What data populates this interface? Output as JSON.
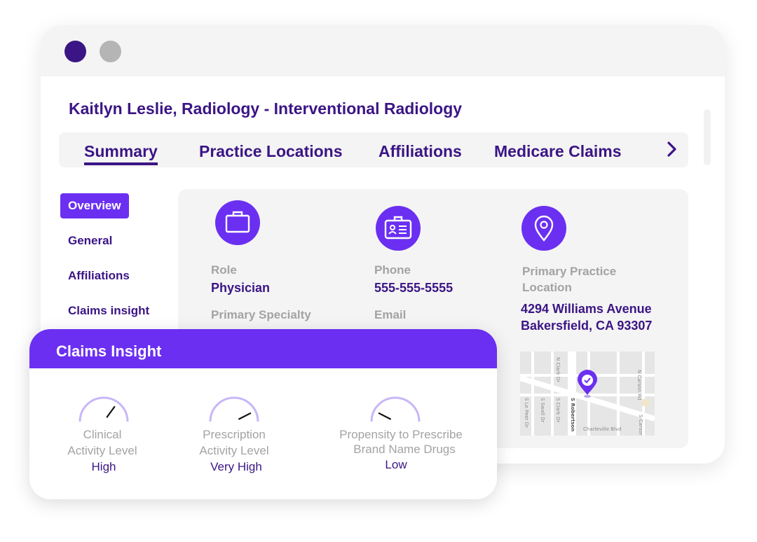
{
  "window": {
    "controls": [
      {
        "name": "close",
        "color": "#3b1585"
      },
      {
        "name": "minimize",
        "color": "#b5b5b5"
      }
    ]
  },
  "header": {
    "title": "Kaitlyn Leslie, Radiology - Interventional Radiology"
  },
  "tabs": [
    {
      "label": "Summary",
      "active": true
    },
    {
      "label": "Practice Locations",
      "active": false
    },
    {
      "label": "Affiliations",
      "active": false
    },
    {
      "label": "Medicare Claims",
      "active": false
    }
  ],
  "tab_next_icon": "chevron-right-icon",
  "sidenav": [
    {
      "label": "Overview",
      "active": true
    },
    {
      "label": "General",
      "active": false
    },
    {
      "label": "Affiliations",
      "active": false
    },
    {
      "label": "Claims insight",
      "active": false
    }
  ],
  "overview": {
    "role": {
      "icon": "briefcase-icon",
      "label": "Role",
      "value": "Physician"
    },
    "specialty": {
      "label": "Primary Specialty"
    },
    "phone": {
      "icon": "id-card-icon",
      "label": "Phone",
      "value": "555-555-5555"
    },
    "email": {
      "label": "Email"
    },
    "location": {
      "icon": "location-pin-icon",
      "label_line1": "Primary Practice",
      "label_line2": "Location",
      "address_line1": "4294 Williams Avenue",
      "address_line2": "Bakersfield, CA 93307"
    },
    "map": {
      "streets": [
        "N Clark Dr",
        "N Carson Rd",
        "S Le Peer Dr",
        "S Swall Dr",
        "S Clark Dr",
        "S Robertson",
        "S Carson",
        "Charleville Blvd"
      ]
    }
  },
  "claims": {
    "title": "Claims Insight",
    "gauges": [
      {
        "label_line1": "Clinical",
        "label_line2": "Activity Level",
        "value": "High",
        "level": 0.7
      },
      {
        "label_line1": "Prescription",
        "label_line2": "Activity Level",
        "value": "Very High",
        "level": 0.85
      },
      {
        "label_line1": "Propensity to Prescribe",
        "label_line2": "Brand Name Drugs",
        "value": "Low",
        "level": 0.15
      }
    ]
  },
  "colors": {
    "accent": "#6b2ff2",
    "brand_dark": "#3b1585",
    "muted_text": "#a3a3a3",
    "panel": "#f4f4f4"
  }
}
